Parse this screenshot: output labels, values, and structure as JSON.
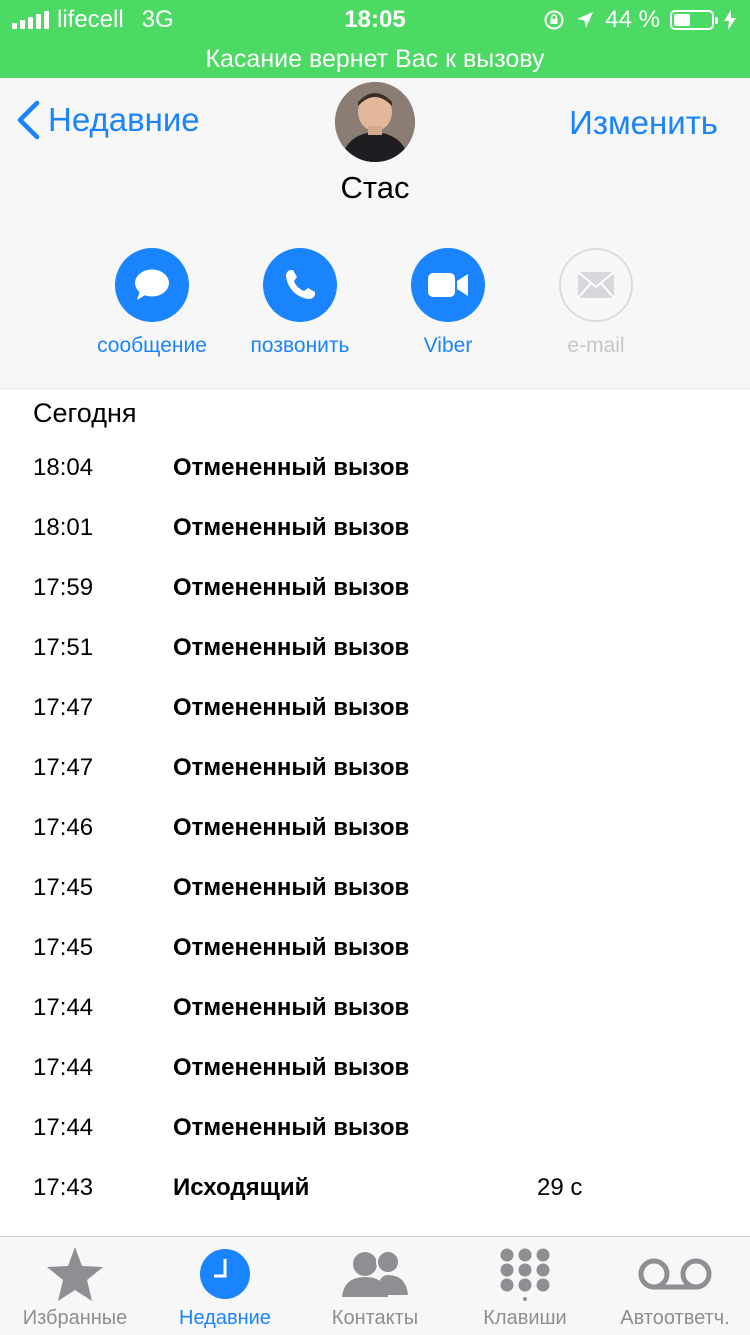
{
  "status": {
    "carrier": "lifecell",
    "network": "3G",
    "time": "18:05",
    "battery": "44 %",
    "battery_level": 0.44
  },
  "call_banner": "Касание вернет Вас к вызову",
  "nav": {
    "back_label": "Недавние",
    "edit_label": "Изменить"
  },
  "contact": {
    "name": "Стас"
  },
  "actions": [
    {
      "label": "сообщение",
      "icon": "message-icon"
    },
    {
      "label": "позвонить",
      "icon": "phone-icon"
    },
    {
      "label": "Viber",
      "icon": "video-icon"
    },
    {
      "label": "e-mail",
      "icon": "mail-icon"
    }
  ],
  "section_title": "Сегодня",
  "calls": [
    {
      "time": "18:04",
      "desc": "Отмененный вызов",
      "duration": ""
    },
    {
      "time": "18:01",
      "desc": "Отмененный вызов",
      "duration": ""
    },
    {
      "time": "17:59",
      "desc": "Отмененный вызов",
      "duration": ""
    },
    {
      "time": "17:51",
      "desc": "Отмененный вызов",
      "duration": ""
    },
    {
      "time": "17:47",
      "desc": "Отмененный вызов",
      "duration": ""
    },
    {
      "time": "17:47",
      "desc": "Отмененный вызов",
      "duration": ""
    },
    {
      "time": "17:46",
      "desc": "Отмененный вызов",
      "duration": ""
    },
    {
      "time": "17:45",
      "desc": "Отмененный вызов",
      "duration": ""
    },
    {
      "time": "17:45",
      "desc": "Отмененный вызов",
      "duration": ""
    },
    {
      "time": "17:44",
      "desc": "Отмененный вызов",
      "duration": ""
    },
    {
      "time": "17:44",
      "desc": "Отмененный вызов",
      "duration": ""
    },
    {
      "time": "17:44",
      "desc": "Отмененный вызов",
      "duration": ""
    },
    {
      "time": "17:43",
      "desc": "Исходящий",
      "duration": "29 с"
    }
  ],
  "tabs": [
    {
      "label": "Избранные",
      "icon": "star-icon"
    },
    {
      "label": "Недавние",
      "icon": "clock-icon"
    },
    {
      "label": "Контакты",
      "icon": "contacts-icon"
    },
    {
      "label": "Клавиши",
      "icon": "keypad-icon"
    },
    {
      "label": "Автоответч.",
      "icon": "voicemail-icon"
    }
  ],
  "colors": {
    "accent": "#1a84ff",
    "call_green": "#4cd964",
    "inactive": "#8e8e93"
  }
}
